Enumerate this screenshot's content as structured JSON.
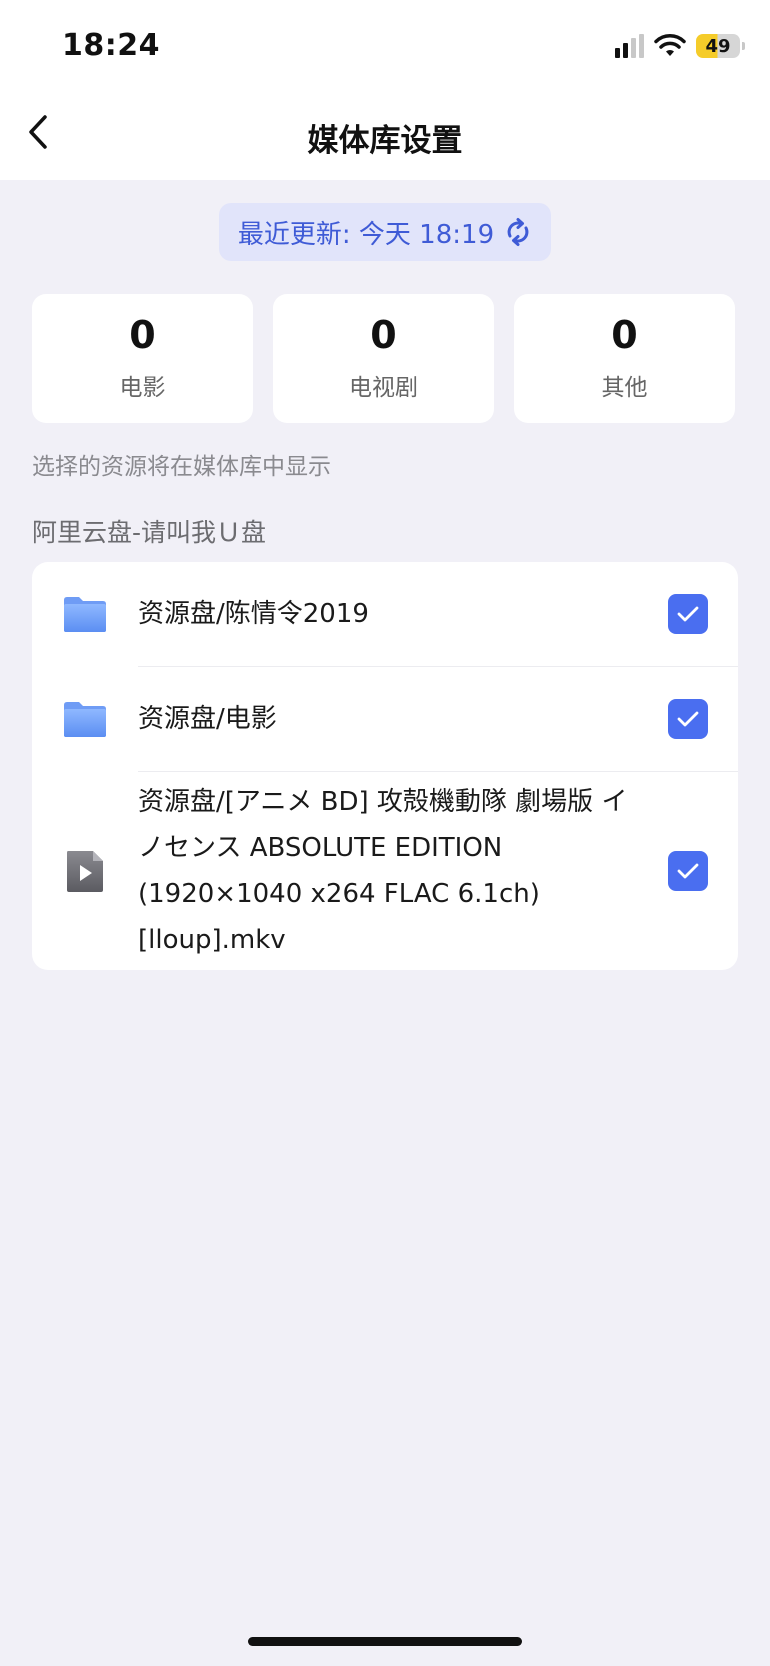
{
  "status_bar": {
    "time": "18:24",
    "battery": "49"
  },
  "header": {
    "title": "媒体库设置"
  },
  "update": {
    "text": "最近更新: 今天 18:19"
  },
  "stats": [
    {
      "value": "0",
      "label": "电影"
    },
    {
      "value": "0",
      "label": "电视剧"
    },
    {
      "value": "0",
      "label": "其他"
    }
  ],
  "hint": "选择的资源将在媒体库中显示",
  "source": {
    "name": "阿里云盘-请叫我Ｕ盘",
    "items": [
      {
        "type": "folder",
        "path": "资源盘/陈情令2019",
        "checked": true
      },
      {
        "type": "folder",
        "path": "资源盘/电影",
        "checked": true
      },
      {
        "type": "video",
        "path": "资源盘/[アニメ BD] 攻殻機動隊 劇場版 イノセンス ABSOLUTE EDITION (1920×1040 x264 FLAC 6.1ch) [lloup].mkv",
        "checked": true
      }
    ]
  },
  "colors": {
    "accent": "#4a6ef0",
    "pill_bg": "#e1e4fa",
    "pill_text": "#3f5bd6",
    "page_bg": "#f1f0f7",
    "battery": "#f5cc2a"
  }
}
